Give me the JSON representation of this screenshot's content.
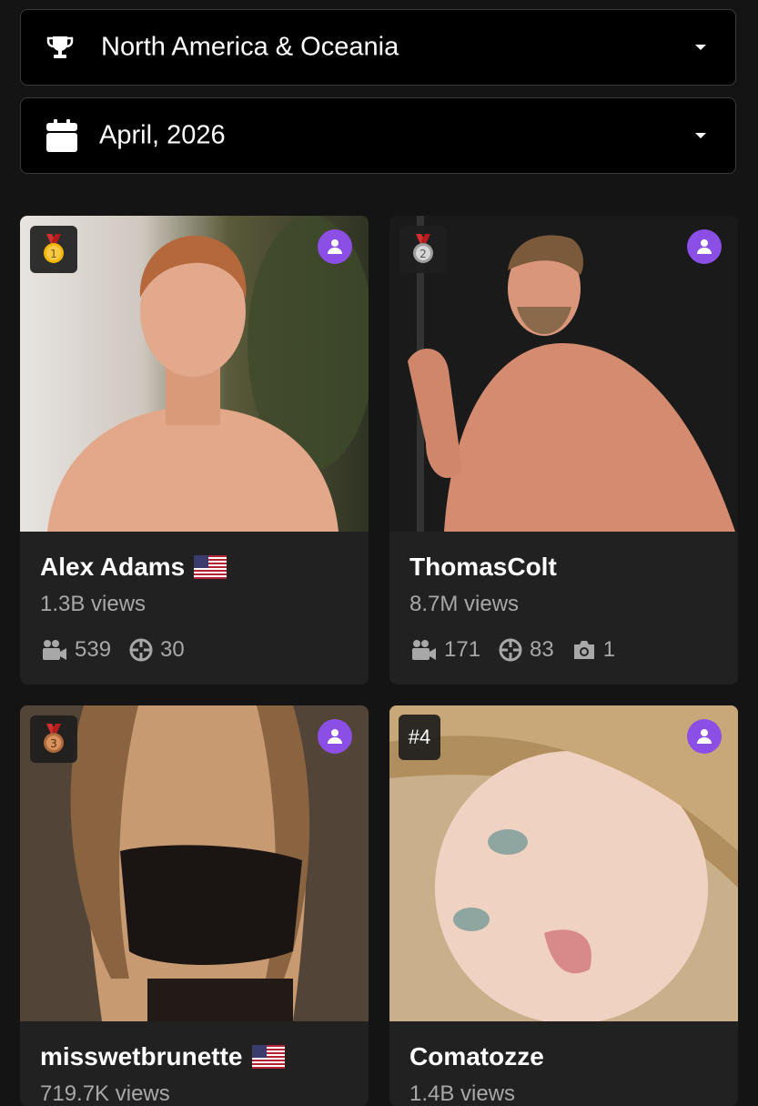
{
  "filters": {
    "region": {
      "label": "North America & Oceania",
      "icon": "trophy-icon"
    },
    "period": {
      "label": "April, 2026",
      "icon": "calendar-icon"
    }
  },
  "cards": [
    {
      "rank": "1",
      "rank_icon": "gold-medal-icon",
      "name": "Alex Adams",
      "flag": "us-flag-icon",
      "views": "1.3B views",
      "videos": "539",
      "photos_sets": "30",
      "images": null
    },
    {
      "rank": "2",
      "rank_icon": "silver-medal-icon",
      "name": "ThomasColt",
      "flag": null,
      "views": "8.7M views",
      "videos": "171",
      "photos_sets": "83",
      "images": "1"
    },
    {
      "rank": "3",
      "rank_icon": "bronze-medal-icon",
      "name": "misswetbrunette",
      "flag": "us-flag-icon",
      "views": "719.7K views"
    },
    {
      "rank": "#4",
      "rank_icon": null,
      "name": "Comatozze",
      "flag": null,
      "views": "1.4B views"
    }
  ],
  "colors": {
    "accent": "#8b4fe6",
    "card_bg": "#212121",
    "page_bg": "#141414",
    "muted_text": "#a8a8a8"
  }
}
